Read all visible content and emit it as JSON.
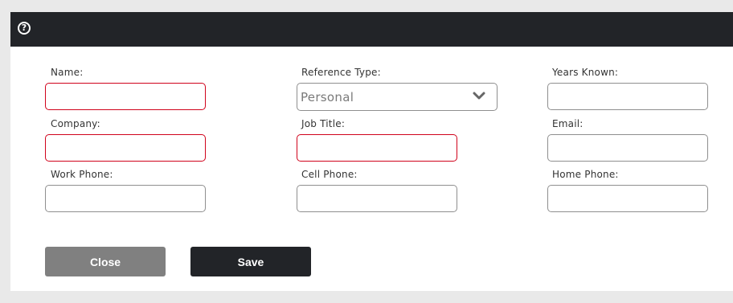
{
  "dialog": {
    "help_icon": "help-icon",
    "help_glyph": "?"
  },
  "form": {
    "name": {
      "label": "Name:",
      "value": ""
    },
    "reference_type": {
      "label": "Reference Type:",
      "value": "Personal",
      "icon": "chevron-down-icon"
    },
    "years_known": {
      "label": "Years Known:",
      "value": ""
    },
    "company": {
      "label": "Company:",
      "value": ""
    },
    "job_title": {
      "label": "Job Title:",
      "value": ""
    },
    "email": {
      "label": "Email:",
      "value": ""
    },
    "work_phone": {
      "label": "Work Phone:",
      "value": ""
    },
    "cell_phone": {
      "label": "Cell Phone:",
      "value": ""
    },
    "home_phone": {
      "label": "Home Phone:",
      "value": ""
    }
  },
  "buttons": {
    "close_label": "Close",
    "save_label": "Save"
  },
  "colors": {
    "titlebar": "#222428",
    "required_border": "#d0021b",
    "close_button": "#808080",
    "save_button": "#222428",
    "page_background": "#e9e9e9"
  }
}
